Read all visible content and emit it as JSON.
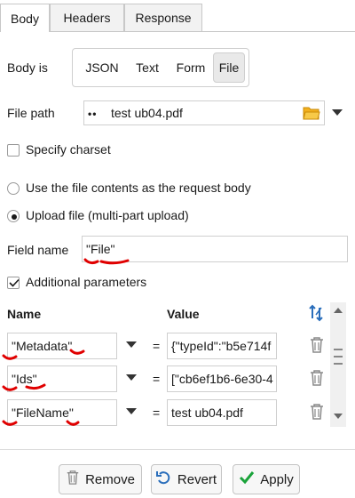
{
  "tabs": [
    {
      "label": "Body",
      "active": true
    },
    {
      "label": "Headers",
      "active": false
    },
    {
      "label": "Response",
      "active": false
    }
  ],
  "body_is": {
    "label": "Body is",
    "options": [
      "JSON",
      "Text",
      "Form",
      "File"
    ],
    "selected": "File"
  },
  "file_path": {
    "label": "File path",
    "value": "test ub04.pdf",
    "icons": [
      "variables-icon",
      "folder-icon",
      "chevron-down-icon"
    ]
  },
  "specify_charset": {
    "label": "Specify charset",
    "checked": false
  },
  "radio_options": [
    {
      "label": "Use the file contents as the request body",
      "selected": false
    },
    {
      "label": "Upload file (multi-part upload)",
      "selected": true
    }
  ],
  "field_name": {
    "label": "Field name",
    "value": "\"File\""
  },
  "additional_parameters": {
    "label": "Additional parameters",
    "checked": true
  },
  "params_table": {
    "headers": {
      "name": "Name",
      "value": "Value"
    },
    "rows": [
      {
        "name": "\"Metadata\"",
        "eq": "=",
        "value": "{\"typeId\":\"b5e714f"
      },
      {
        "name": "\"Ids\"",
        "eq": "=",
        "value": "[\"cb6ef1b6-6e30-4"
      },
      {
        "name": "\"FileName\"",
        "eq": "=",
        "value": "test ub04.pdf"
      }
    ]
  },
  "buttons": {
    "remove": "Remove",
    "revert": "Revert",
    "apply": "Apply"
  },
  "colors": {
    "annotation_red": "#e00000",
    "folder_yellow": "#f2b01e",
    "revert_blue": "#2a6ebb",
    "apply_green": "#1aa33a",
    "sort_blue": "#2a6ebb"
  }
}
